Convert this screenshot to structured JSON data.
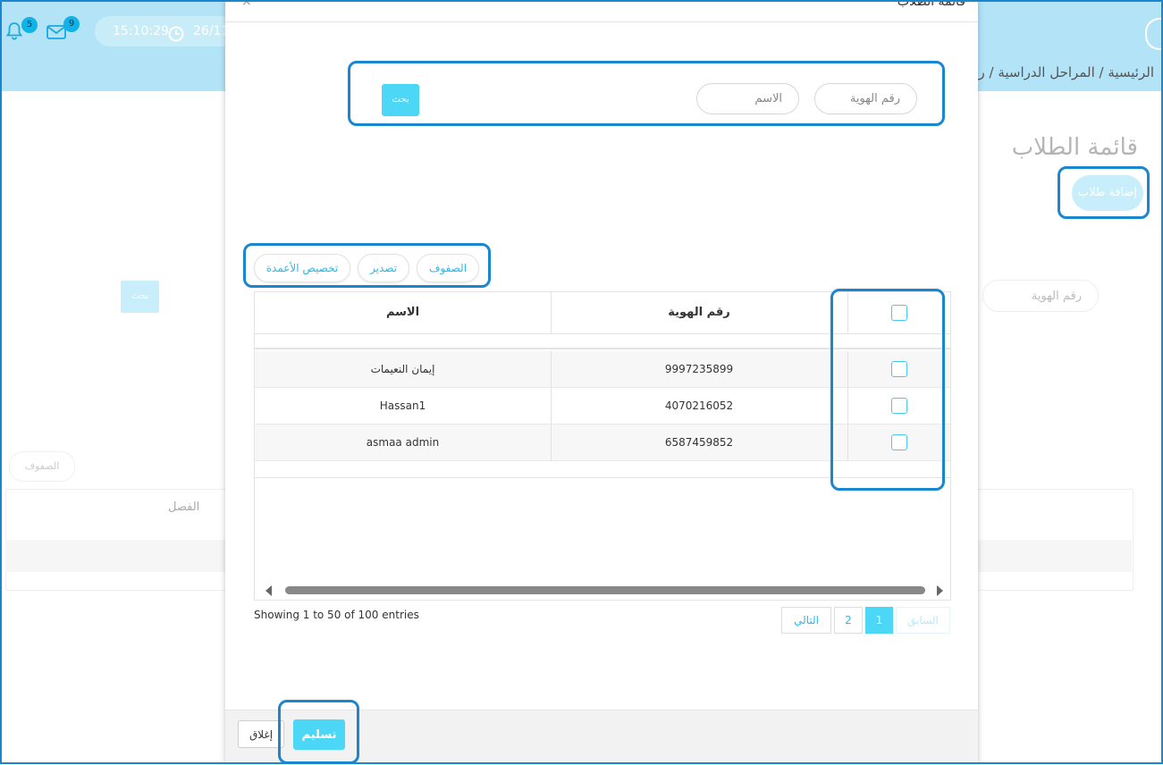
{
  "header": {
    "notifications_count": "5",
    "messages_count": "9",
    "time": "15:10:29",
    "date_partial": "26/11",
    "breadcrumb": "الرئيسية / المراحل الدراسية / ر"
  },
  "background_page": {
    "title": "قائمة الطلاب",
    "add_button": "إضافة طلاب",
    "search_button": "بحث",
    "id_placeholder": "رقم الهوية",
    "rows_button": "الصفوف",
    "column_class": "الفصل"
  },
  "modal": {
    "title": "قائمة الطلاب",
    "close_symbol": "×",
    "search": {
      "button": "بحث",
      "name_placeholder": "الاسم",
      "id_placeholder": "رقم الهوية"
    },
    "toolbar": {
      "rows": "الصفوف",
      "export": "تصدير",
      "columns": "تخصيص الأعمدة"
    },
    "table": {
      "headers": {
        "name": "الاسم",
        "id": "رقم الهوية"
      },
      "rows": [
        {
          "name": "إيمان النعيمات",
          "id": "9997235899"
        },
        {
          "name": "Hassan1",
          "id": "4070216052"
        },
        {
          "name": "asmaa admin",
          "id": "6587459852"
        }
      ]
    },
    "info": "Showing 1 to 50 of 100 entries",
    "pagination": {
      "prev": "السابق",
      "page1": "1",
      "page2": "2",
      "next": "التالي"
    },
    "footer": {
      "close": "إغلاق",
      "submit": "تسليم"
    }
  },
  "colors": {
    "accent": "#4dd7f7",
    "header_bg": "#b3e3f7",
    "highlight": "#1a86d0"
  }
}
